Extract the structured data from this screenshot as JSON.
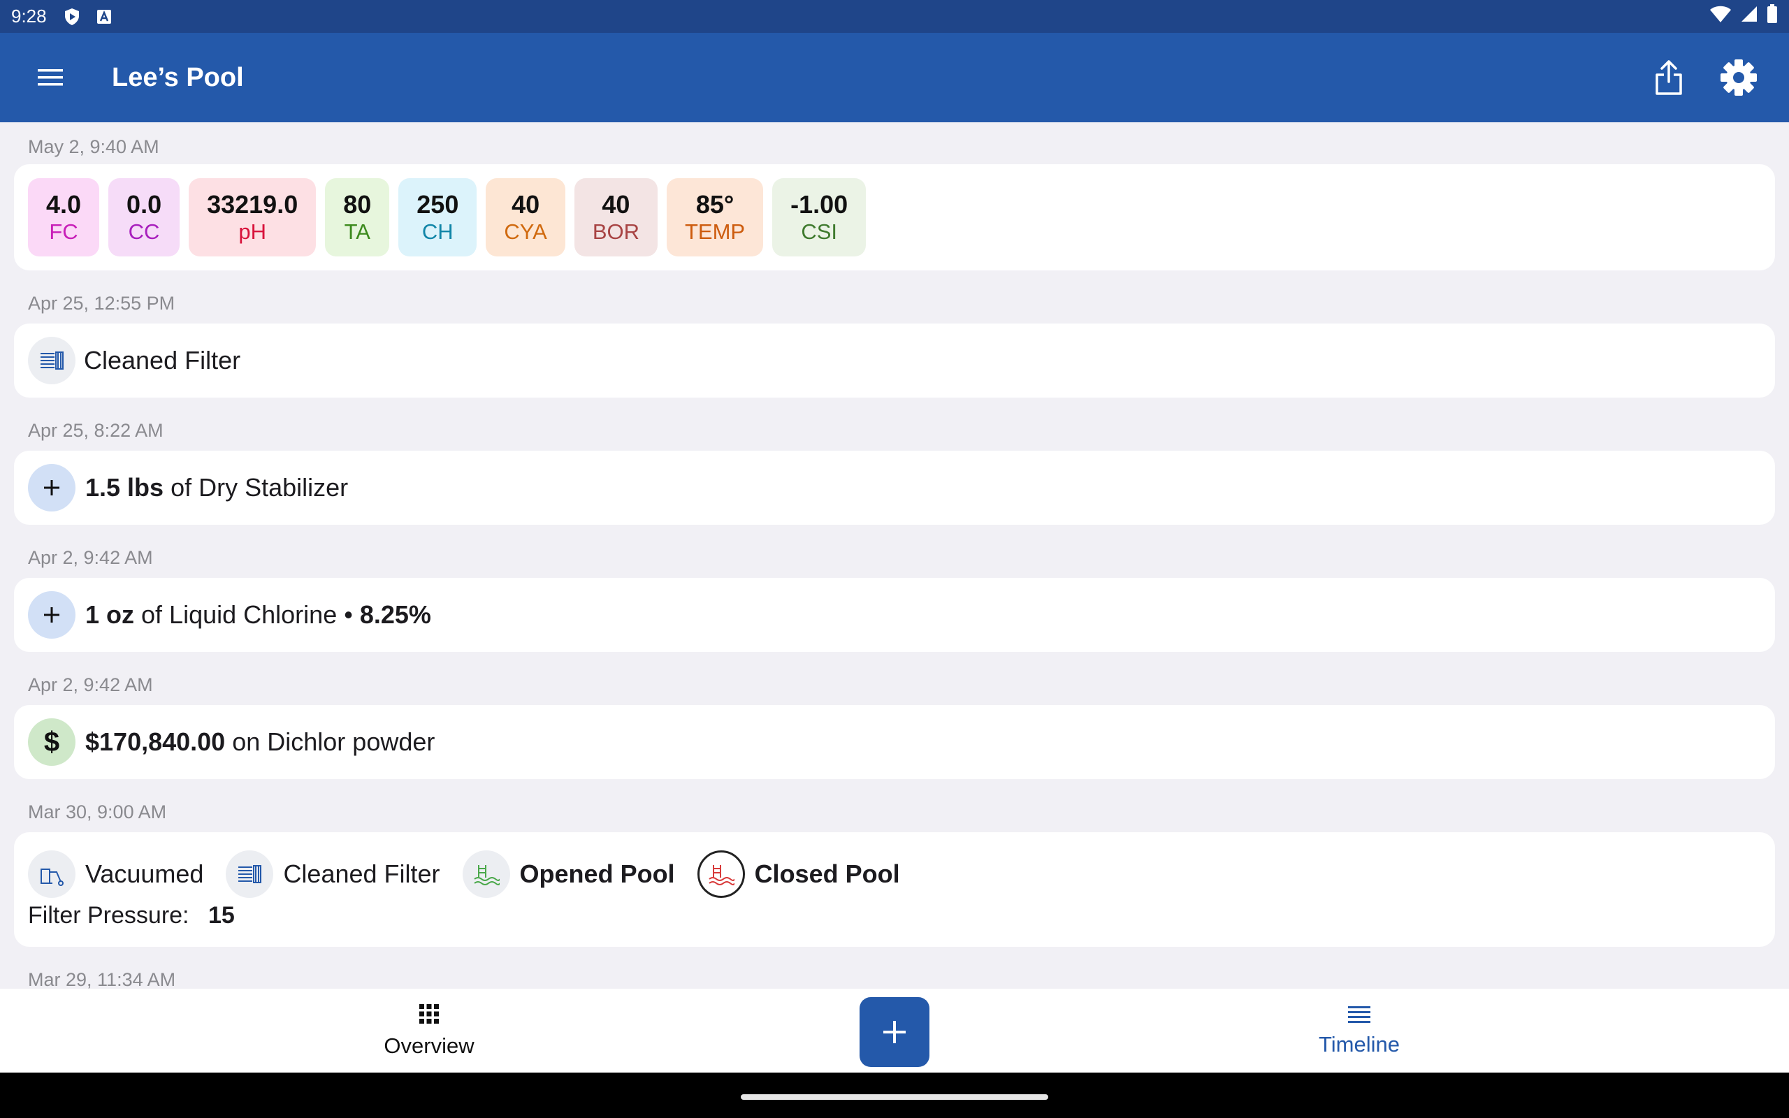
{
  "status_bar": {
    "time": "9:28"
  },
  "app_bar": {
    "title": "Lee’s Pool"
  },
  "timeline": {
    "entry1": {
      "timestamp": "May 2, 9:40 AM",
      "readings": [
        {
          "value": "4.0",
          "label": "FC",
          "bg": "#fbd9f7",
          "color": "#c81fb8"
        },
        {
          "value": "0.0",
          "label": "CC",
          "bg": "#f6dcf8",
          "color": "#a81fbd"
        },
        {
          "value": "33219.0",
          "label": "pH",
          "bg": "#fde0e4",
          "color": "#d8133c"
        },
        {
          "value": "80",
          "label": "TA",
          "bg": "#e7f6dd",
          "color": "#3c8a1d"
        },
        {
          "value": "250",
          "label": "CH",
          "bg": "#dcf3fb",
          "color": "#1286a8"
        },
        {
          "value": "40",
          "label": "CYA",
          "bg": "#fde6d4",
          "color": "#d06a0f"
        },
        {
          "value": "40",
          "label": "BOR",
          "bg": "#f3e4e4",
          "color": "#a84444"
        },
        {
          "value": "85°",
          "label": "TEMP",
          "bg": "#fde6d7",
          "color": "#cd5c0e"
        },
        {
          "value": "-1.00",
          "label": "CSI",
          "bg": "#ebf3e6",
          "color": "#3f7a2e"
        }
      ]
    },
    "entry2": {
      "timestamp": "Apr 25, 12:55 PM",
      "text": "Cleaned Filter"
    },
    "entry3": {
      "timestamp": "Apr 25, 8:22 AM",
      "amount": "1.5 lbs",
      "of": "of Dry Stabilizer"
    },
    "entry4": {
      "timestamp": "Apr 2, 9:42 AM",
      "amount": "1 oz",
      "of": "of Liquid Chlorine",
      "sep": "•",
      "concentration": "8.25%"
    },
    "entry5": {
      "timestamp": "Apr 2, 9:42 AM",
      "amount": "$170,840.00",
      "rest": "on Dichlor powder"
    },
    "entry6": {
      "timestamp": "Mar 30, 9:00 AM",
      "services": [
        "Vacuumed",
        "Cleaned Filter",
        "Opened Pool",
        "Closed Pool"
      ],
      "pressure_label": "Filter Pressure:",
      "pressure_value": "15"
    },
    "entry7": {
      "timestamp": "Mar 29, 11:34 AM"
    }
  },
  "bottom_nav": {
    "overview": "Overview",
    "timeline": "Timeline"
  },
  "colors": {
    "primary": "#2459aa",
    "status_bar": "#1f4589",
    "background": "#f1f0f5"
  }
}
